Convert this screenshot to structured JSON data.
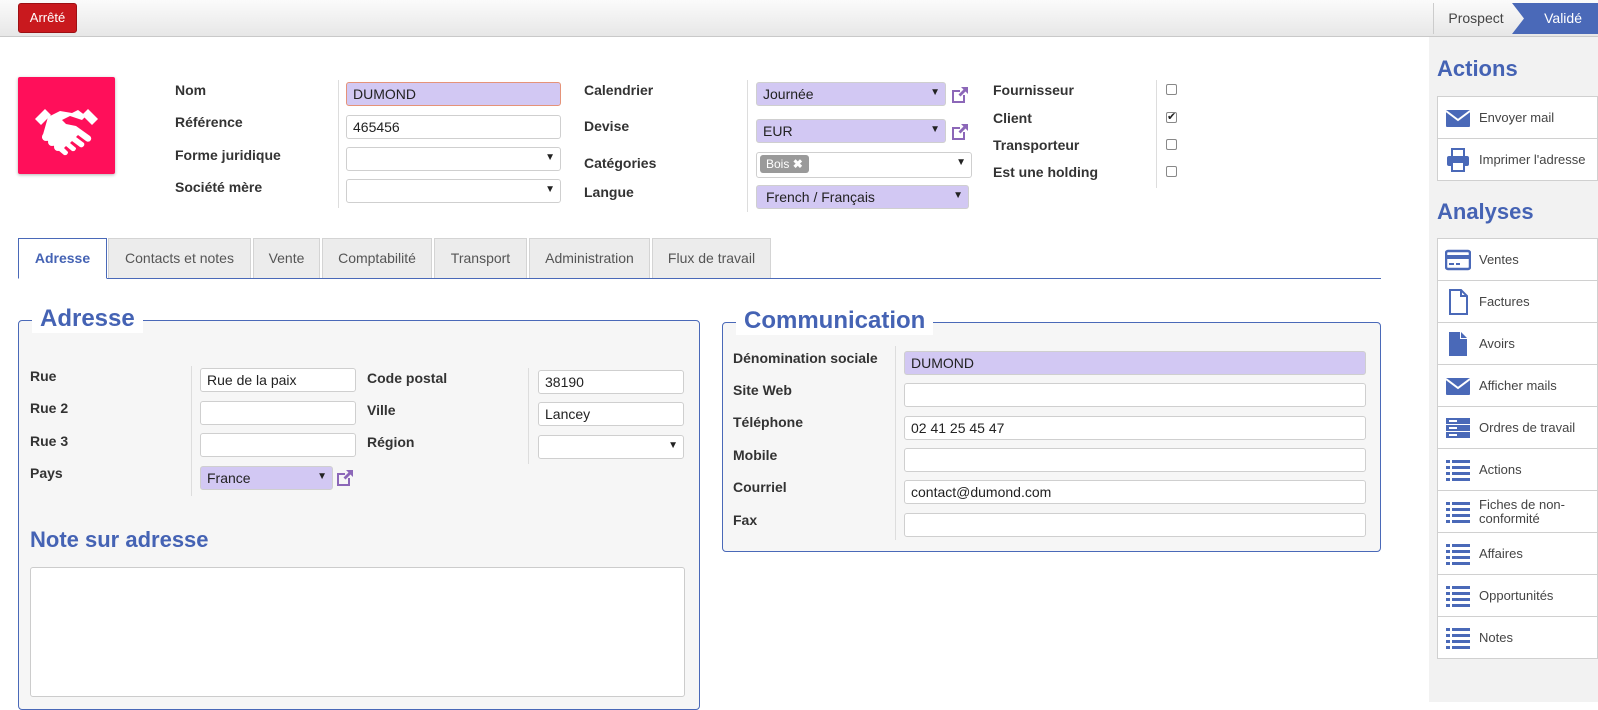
{
  "topbar": {
    "stop_label": "Arrêté",
    "status_steps": [
      "Prospect",
      "Validé"
    ]
  },
  "header": {
    "labels": {
      "name": "Nom",
      "reference": "Référence",
      "legal_form": "Forme juridique",
      "parent": "Société mère",
      "calendar": "Calendrier",
      "currency": "Devise",
      "categories": "Catégories",
      "language": "Langue",
      "supplier": "Fournisseur",
      "customer": "Client",
      "carrier": "Transporteur",
      "holding": "Est une holding"
    },
    "values": {
      "name": "DUMOND",
      "reference": "465456",
      "legal_form": "",
      "parent": "",
      "calendar": "Journée",
      "currency": "EUR",
      "category_tag": "Bois",
      "language": "French / Français"
    },
    "checks": {
      "supplier": false,
      "customer": true,
      "carrier": false,
      "holding": false
    }
  },
  "tabs": [
    "Adresse",
    "Contacts et notes",
    "Vente",
    "Comptabilité",
    "Transport",
    "Administration",
    "Flux de travail"
  ],
  "address": {
    "title": "Adresse",
    "labels": {
      "street": "Rue",
      "street2": "Rue 2",
      "street3": "Rue 3",
      "country": "Pays",
      "zip": "Code postal",
      "city": "Ville",
      "region": "Région"
    },
    "values": {
      "street": "Rue de la paix",
      "street2": "",
      "street3": "",
      "country": "France",
      "zip": "38190",
      "city": "Lancey",
      "region": ""
    },
    "note_title": "Note sur adresse"
  },
  "communication": {
    "title": "Communication",
    "labels": {
      "social": "Dénomination sociale",
      "web": "Site Web",
      "phone": "Téléphone",
      "mobile": "Mobile",
      "email": "Courriel",
      "fax": "Fax"
    },
    "values": {
      "social": "DUMOND",
      "web": "",
      "phone": "02 41 25 45 47",
      "mobile": "",
      "email": "contact@dumond.com",
      "fax": ""
    }
  },
  "sidebar": {
    "actions_title": "Actions",
    "actions": [
      {
        "label": "Envoyer mail",
        "icon": "envelope-icon"
      },
      {
        "label": "Imprimer l'adresse",
        "icon": "printer-icon"
      }
    ],
    "analyses_title": "Analyses",
    "analyses": [
      {
        "label": "Ventes",
        "icon": "credit-card-icon"
      },
      {
        "label": "Factures",
        "icon": "document-outline-icon"
      },
      {
        "label": "Avoirs",
        "icon": "document-filled-icon"
      },
      {
        "label": "Afficher mails",
        "icon": "envelope-icon"
      },
      {
        "label": "Ordres de travail",
        "icon": "server-icon"
      },
      {
        "label": "Actions",
        "icon": "list-icon"
      },
      {
        "label": "Fiches de non-conformité",
        "icon": "list-icon"
      },
      {
        "label": "Affaires",
        "icon": "list-icon"
      },
      {
        "label": "Opportunités",
        "icon": "list-icon"
      },
      {
        "label": "Notes",
        "icon": "list-icon"
      }
    ]
  },
  "colors": {
    "accent": "#4a69b8",
    "stop": "#c9191e",
    "required_field": "#d2c8f3",
    "logo": "#ff0f5a"
  }
}
